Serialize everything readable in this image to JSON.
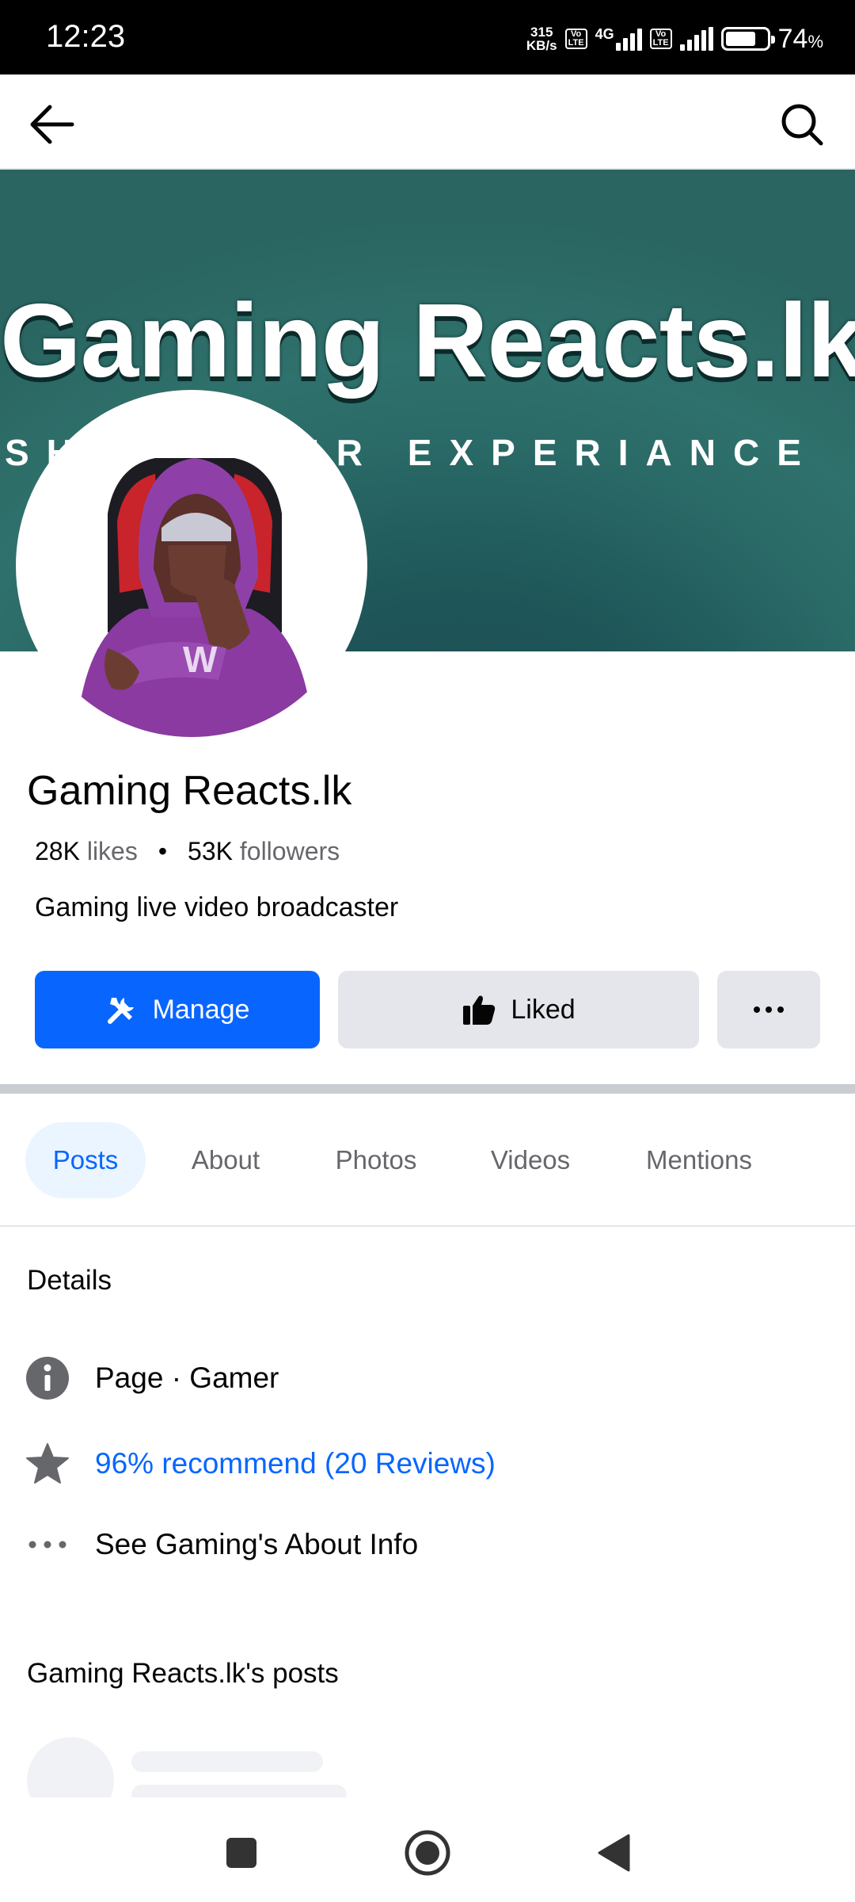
{
  "status_bar": {
    "time": "12:23",
    "net_speed_value": "315",
    "net_speed_unit": "KB/s",
    "sim_badge_top": "Vo",
    "sim_badge_bottom": "LTE",
    "network_type": "4G",
    "battery_percent": "74",
    "battery_percent_sign": "%",
    "battery_level": 0.74
  },
  "page": {
    "cover_title": "Gaming Reacts.lk",
    "cover_tagline": "SHARE OUR EXPERIANCE",
    "name": "Gaming Reacts.lk",
    "likes_count": "28K",
    "likes_label": "likes",
    "stats_separator": "•",
    "followers_count": "53K",
    "followers_label": "followers",
    "category": "Gaming live video broadcaster"
  },
  "actions": {
    "manage_label": "Manage",
    "liked_label": "Liked",
    "manage_icon": "tools-icon",
    "liked_icon": "thumbs-up-icon",
    "more_icon": "more-dots-icon"
  },
  "tabs": [
    {
      "label": "Posts",
      "active": true
    },
    {
      "label": "About",
      "active": false
    },
    {
      "label": "Photos",
      "active": false
    },
    {
      "label": "Videos",
      "active": false
    },
    {
      "label": "Mentions",
      "active": false
    }
  ],
  "details": {
    "title": "Details",
    "type_text": "Page · Gamer",
    "recommend_text": "96% recommend (20 Reviews)",
    "about_text": "See Gaming's About Info"
  },
  "posts_section": {
    "title": "Gaming Reacts.lk's posts"
  },
  "colors": {
    "accent": "#0866ff",
    "secondary_button": "#e4e6eb",
    "muted_text": "#65676b",
    "cover_teal": "#2a6561"
  }
}
